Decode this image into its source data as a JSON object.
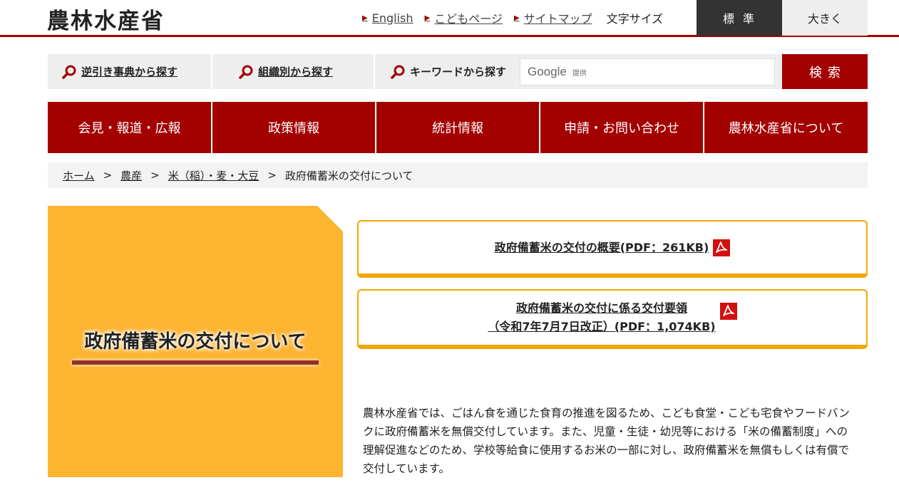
{
  "header": {
    "logo": "農林水産省",
    "links": [
      {
        "label": "English"
      },
      {
        "label": "こどもページ"
      },
      {
        "label": "サイトマップ"
      }
    ],
    "fontsize_label": "文字サイズ",
    "size_standard": "標準",
    "size_large": "大きく"
  },
  "search": {
    "reverse_dict": "逆引き事典から探す",
    "by_org": "組織別から探す",
    "keyword": "キーワードから探す",
    "google_brand": "Google",
    "google_provided": "提供",
    "button": "検索"
  },
  "nav": [
    {
      "label": "会見・報道・広報"
    },
    {
      "label": "政策情報"
    },
    {
      "label": "統計情報"
    },
    {
      "label": "申請・お問い合わせ"
    },
    {
      "label": "農林水産省について"
    }
  ],
  "breadcrumb": {
    "items": [
      {
        "label": "ホーム"
      },
      {
        "label": "農産"
      },
      {
        "label": "米（稲）・麦・大豆"
      }
    ],
    "separator": ">",
    "current": "政府備蓄米の交付について"
  },
  "page": {
    "title": "政府備蓄米の交付について",
    "pdf_links": [
      {
        "line1": "政府備蓄米の交付の概要(PDF：261KB)"
      },
      {
        "line1": "政府備蓄米の交付に係る交付要領",
        "line2": "（令和7年7月7日改正）(PDF：1,074KB)"
      }
    ],
    "description": "農林水産省では、ごはん食を通じた食育の推進を図るため、こども食堂・こども宅食やフードバンクに政府備蓄米を無償交付しています。また、児童・生徒・幼児等における「米の備蓄制度」への理解促進などのため、学校等給食に使用するお米の一部に対し、政府備蓄米を無償もしくは有償で交付しています。"
  },
  "colors": {
    "brand_red": "#a30000",
    "title_orange": "#fcb431",
    "box_border": "#f3a600",
    "underline_brown": "#93302b"
  },
  "icons": [
    "magnifier-icon",
    "pdf-icon",
    "triangle-bullet-icon"
  ]
}
